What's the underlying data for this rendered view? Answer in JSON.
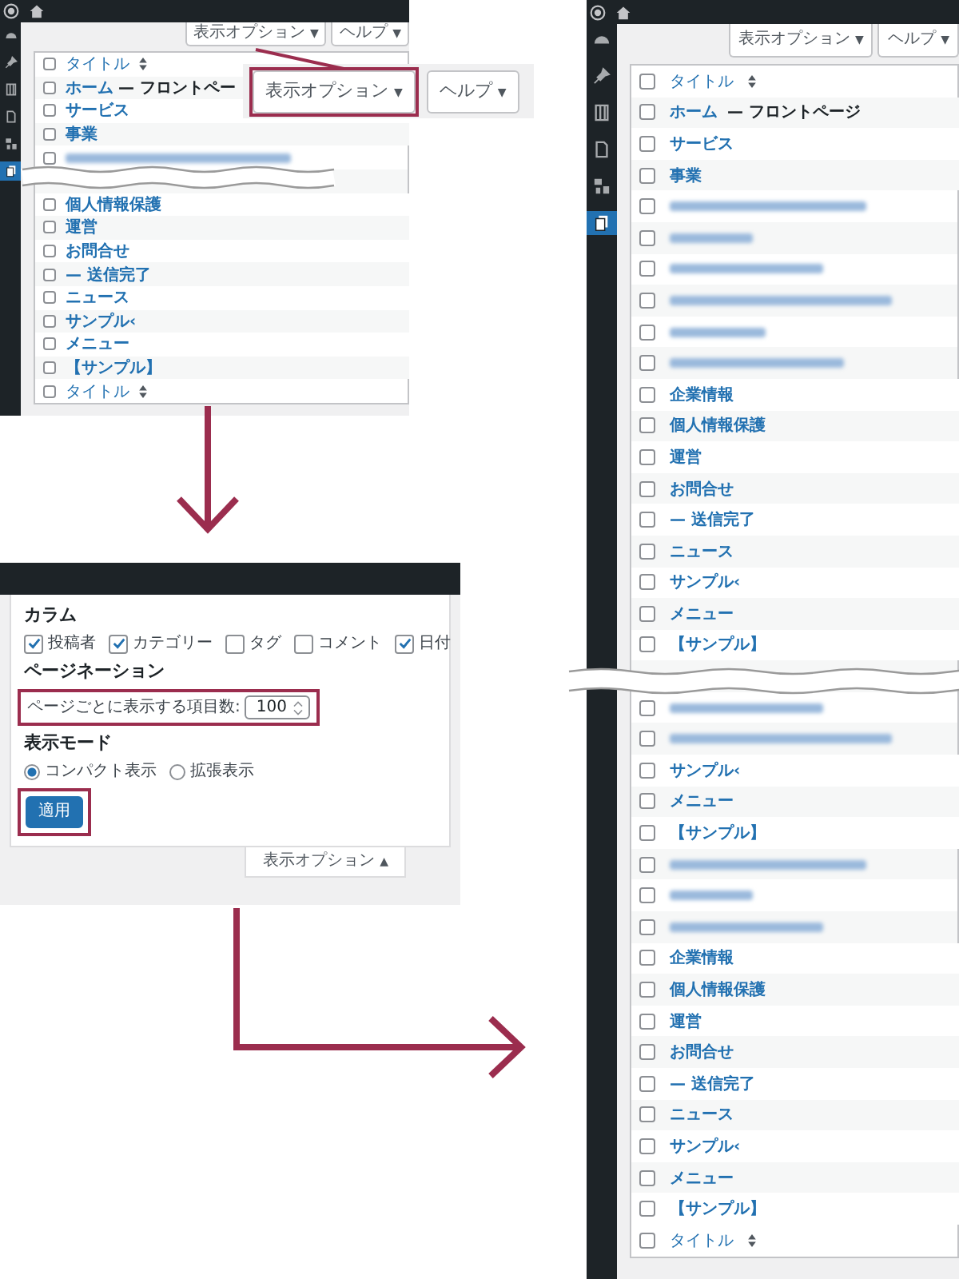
{
  "before": {
    "sidebar": [
      {
        "kind": "gauge",
        "selected": false
      },
      {
        "kind": "pin",
        "selected": false
      },
      {
        "kind": "columns",
        "selected": false
      },
      {
        "kind": "document",
        "selected": false
      },
      {
        "kind": "tools",
        "selected": false
      },
      {
        "kind": "documents",
        "selected": true
      }
    ],
    "buttons": [
      {
        "label": "表示オプション",
        "caret": "▼"
      },
      {
        "label": "ヘルプ",
        "caret": "▼"
      }
    ],
    "rows": [
      {
        "kind": "heading",
        "title": "タイトル",
        "checked": false
      },
      {
        "kind": "page",
        "title": "ホーム",
        "suffix": "— フロントペー",
        "checked": false
      },
      {
        "kind": "page",
        "title": "サービス",
        "checked": false
      },
      {
        "kind": "page",
        "title": "事業",
        "checked": false
      },
      {
        "kind": "blurred",
        "checked": false
      },
      {
        "kind": "break"
      },
      {
        "kind": "page",
        "title": "個人情報保護",
        "checked": false
      },
      {
        "kind": "page",
        "title": "運営",
        "checked": false
      },
      {
        "kind": "page",
        "title": "お問合せ",
        "checked": false
      },
      {
        "kind": "page",
        "title": "— 送信完了",
        "checked": false
      },
      {
        "kind": "page",
        "title": "ニュース",
        "checked": false
      },
      {
        "kind": "page",
        "title": "サンプル‹",
        "checked": false
      },
      {
        "kind": "page",
        "title": "メニュー",
        "checked": false
      },
      {
        "kind": "page",
        "title": "【サンプル】",
        "checked": false
      },
      {
        "kind": "heading",
        "title": "タイトル",
        "checked": false
      }
    ],
    "callout": {
      "buttons": [
        {
          "label": "表示オプション",
          "caret": "▼",
          "highlighted": true
        },
        {
          "label": "ヘルプ",
          "caret": "▼",
          "highlighted": false
        }
      ]
    }
  },
  "options_panel": {
    "columns_heading": "カラム",
    "columns": [
      {
        "label": "投稿者",
        "checked": true
      },
      {
        "label": "カテゴリー",
        "checked": true
      },
      {
        "label": "タグ",
        "checked": false
      },
      {
        "label": "コメント",
        "checked": false
      },
      {
        "label": "日付",
        "checked": true
      }
    ],
    "pagination_heading": "ページネーション",
    "per_page": {
      "label": "ページごとに表示する項目数:",
      "value": "100",
      "highlighted": true
    },
    "view_heading": "表示モード",
    "modes": [
      {
        "label": "コンパクト表示",
        "selected": true
      },
      {
        "label": "拡張表示",
        "selected": false
      }
    ],
    "apply": {
      "label": "適用",
      "highlighted": true
    },
    "tab": {
      "label": "表示オプション",
      "caret": "▲"
    }
  },
  "after": {
    "sidebar": [
      {
        "kind": "gauge",
        "selected": false
      },
      {
        "kind": "pin",
        "selected": false
      },
      {
        "kind": "columns",
        "selected": false
      },
      {
        "kind": "document",
        "selected": false
      },
      {
        "kind": "tools",
        "selected": false
      },
      {
        "kind": "documents",
        "selected": true
      }
    ],
    "buttons": [
      {
        "label": "表示オプション",
        "caret": "▼"
      },
      {
        "label": "ヘルプ",
        "caret": "▼"
      }
    ],
    "rows": [
      {
        "kind": "heading",
        "title": "タイトル",
        "checked": false
      },
      {
        "kind": "page",
        "title": "ホーム",
        "suffix": "— フロントページ",
        "checked": false
      },
      {
        "kind": "page",
        "title": "サービス",
        "checked": false
      },
      {
        "kind": "page",
        "title": "事業",
        "checked": false
      },
      {
        "kind": "blurred",
        "checked": false
      },
      {
        "kind": "blurred",
        "checked": false
      },
      {
        "kind": "blurred",
        "checked": false
      },
      {
        "kind": "blurred",
        "checked": false
      },
      {
        "kind": "blurred",
        "checked": false
      },
      {
        "kind": "blurred",
        "checked": false
      },
      {
        "kind": "page",
        "title": "企業情報",
        "checked": false
      },
      {
        "kind": "page",
        "title": "個人情報保護",
        "checked": false
      },
      {
        "kind": "page",
        "title": "運営",
        "checked": false
      },
      {
        "kind": "page",
        "title": "お問合せ",
        "checked": false
      },
      {
        "kind": "page",
        "title": "— 送信完了",
        "checked": false
      },
      {
        "kind": "page",
        "title": "ニュース",
        "checked": false
      },
      {
        "kind": "page",
        "title": "サンプル‹",
        "checked": false
      },
      {
        "kind": "page",
        "title": "メニュー",
        "checked": false
      },
      {
        "kind": "page",
        "title": "【サンプル】",
        "checked": false
      },
      {
        "kind": "break"
      },
      {
        "kind": "blurred",
        "checked": false
      },
      {
        "kind": "blurred",
        "checked": false
      },
      {
        "kind": "page",
        "title": "サンプル‹",
        "checked": false
      },
      {
        "kind": "page",
        "title": "メニュー",
        "checked": false
      },
      {
        "kind": "page",
        "title": "【サンプル】",
        "checked": false
      },
      {
        "kind": "blurred",
        "checked": false
      },
      {
        "kind": "blurred",
        "checked": false
      },
      {
        "kind": "blurred",
        "checked": false
      },
      {
        "kind": "page",
        "title": "企業情報",
        "checked": false
      },
      {
        "kind": "page",
        "title": "個人情報保護",
        "checked": false
      },
      {
        "kind": "page",
        "title": "運営",
        "checked": false
      },
      {
        "kind": "page",
        "title": "お問合せ",
        "checked": false
      },
      {
        "kind": "page",
        "title": "— 送信完了",
        "checked": false
      },
      {
        "kind": "page",
        "title": "ニュース",
        "checked": false
      },
      {
        "kind": "page",
        "title": "サンプル‹",
        "checked": false
      },
      {
        "kind": "page",
        "title": "メニュー",
        "checked": false
      },
      {
        "kind": "page",
        "title": "【サンプル】",
        "checked": false
      },
      {
        "kind": "heading",
        "title": "タイトル",
        "checked": false
      }
    ]
  }
}
